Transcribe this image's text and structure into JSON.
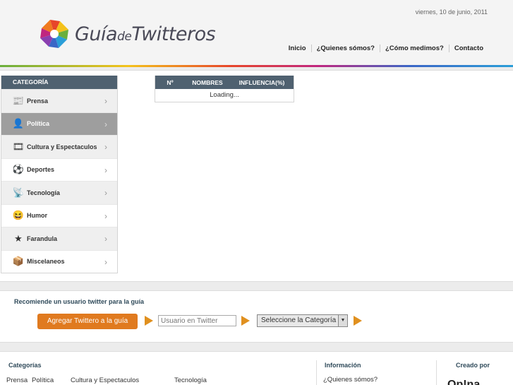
{
  "header": {
    "date": "viernes, 10 de junio, 2011",
    "logo": {
      "main": "Guía",
      "de": "de",
      "brand": "Twitteros"
    },
    "nav": [
      "Inicio",
      "¿Quienes sómos?",
      "¿Cómo medimos?",
      "Contacto"
    ]
  },
  "sidebar": {
    "heading": "CATEGORÍA",
    "items": [
      {
        "label": "Prensa",
        "icon": "newspaper-icon",
        "glyph": "📰"
      },
      {
        "label": "Política",
        "icon": "politician-icon",
        "glyph": "👤"
      },
      {
        "label": "Cultura y Espectaculos",
        "icon": "film-reel-icon",
        "glyph": "🎞"
      },
      {
        "label": "Deportes",
        "icon": "soccer-ball-icon",
        "glyph": "⚽"
      },
      {
        "label": "Tecnología",
        "icon": "satellite-icon",
        "glyph": "📡"
      },
      {
        "label": "Humor",
        "icon": "smiley-icon",
        "glyph": "😆"
      },
      {
        "label": "Farandula",
        "icon": "star-icon",
        "glyph": "★"
      },
      {
        "label": "Miscelaneos",
        "icon": "box-icon",
        "glyph": "📦"
      }
    ],
    "arrow": "›"
  },
  "ranking": {
    "columns": [
      "Nº",
      "NOMBRES",
      "INFLUENCIA(%)"
    ],
    "status": "Loading..."
  },
  "recommend": {
    "title": "Recomiende un usuario twitter para la guía",
    "button": "Agregar Twittero a la guía",
    "input_placeholder": "Usuario en Twitter",
    "select_value": "Seleccione la Categoría",
    "select_arrow": "▼"
  },
  "footer": {
    "categorias_title": "Categorías",
    "links": [
      "Prensa",
      "Política",
      "Cultura y Espectaculos",
      "Tecnología"
    ],
    "informacion_title": "Información",
    "info_link": "¿Quienes sómos?",
    "creado_title": "Creado por",
    "creado_logo": "Op!na"
  },
  "colors": {
    "table_header": "#4f6170",
    "accent_orange": "#e07a1f",
    "active_category": "#9e9e9e"
  }
}
